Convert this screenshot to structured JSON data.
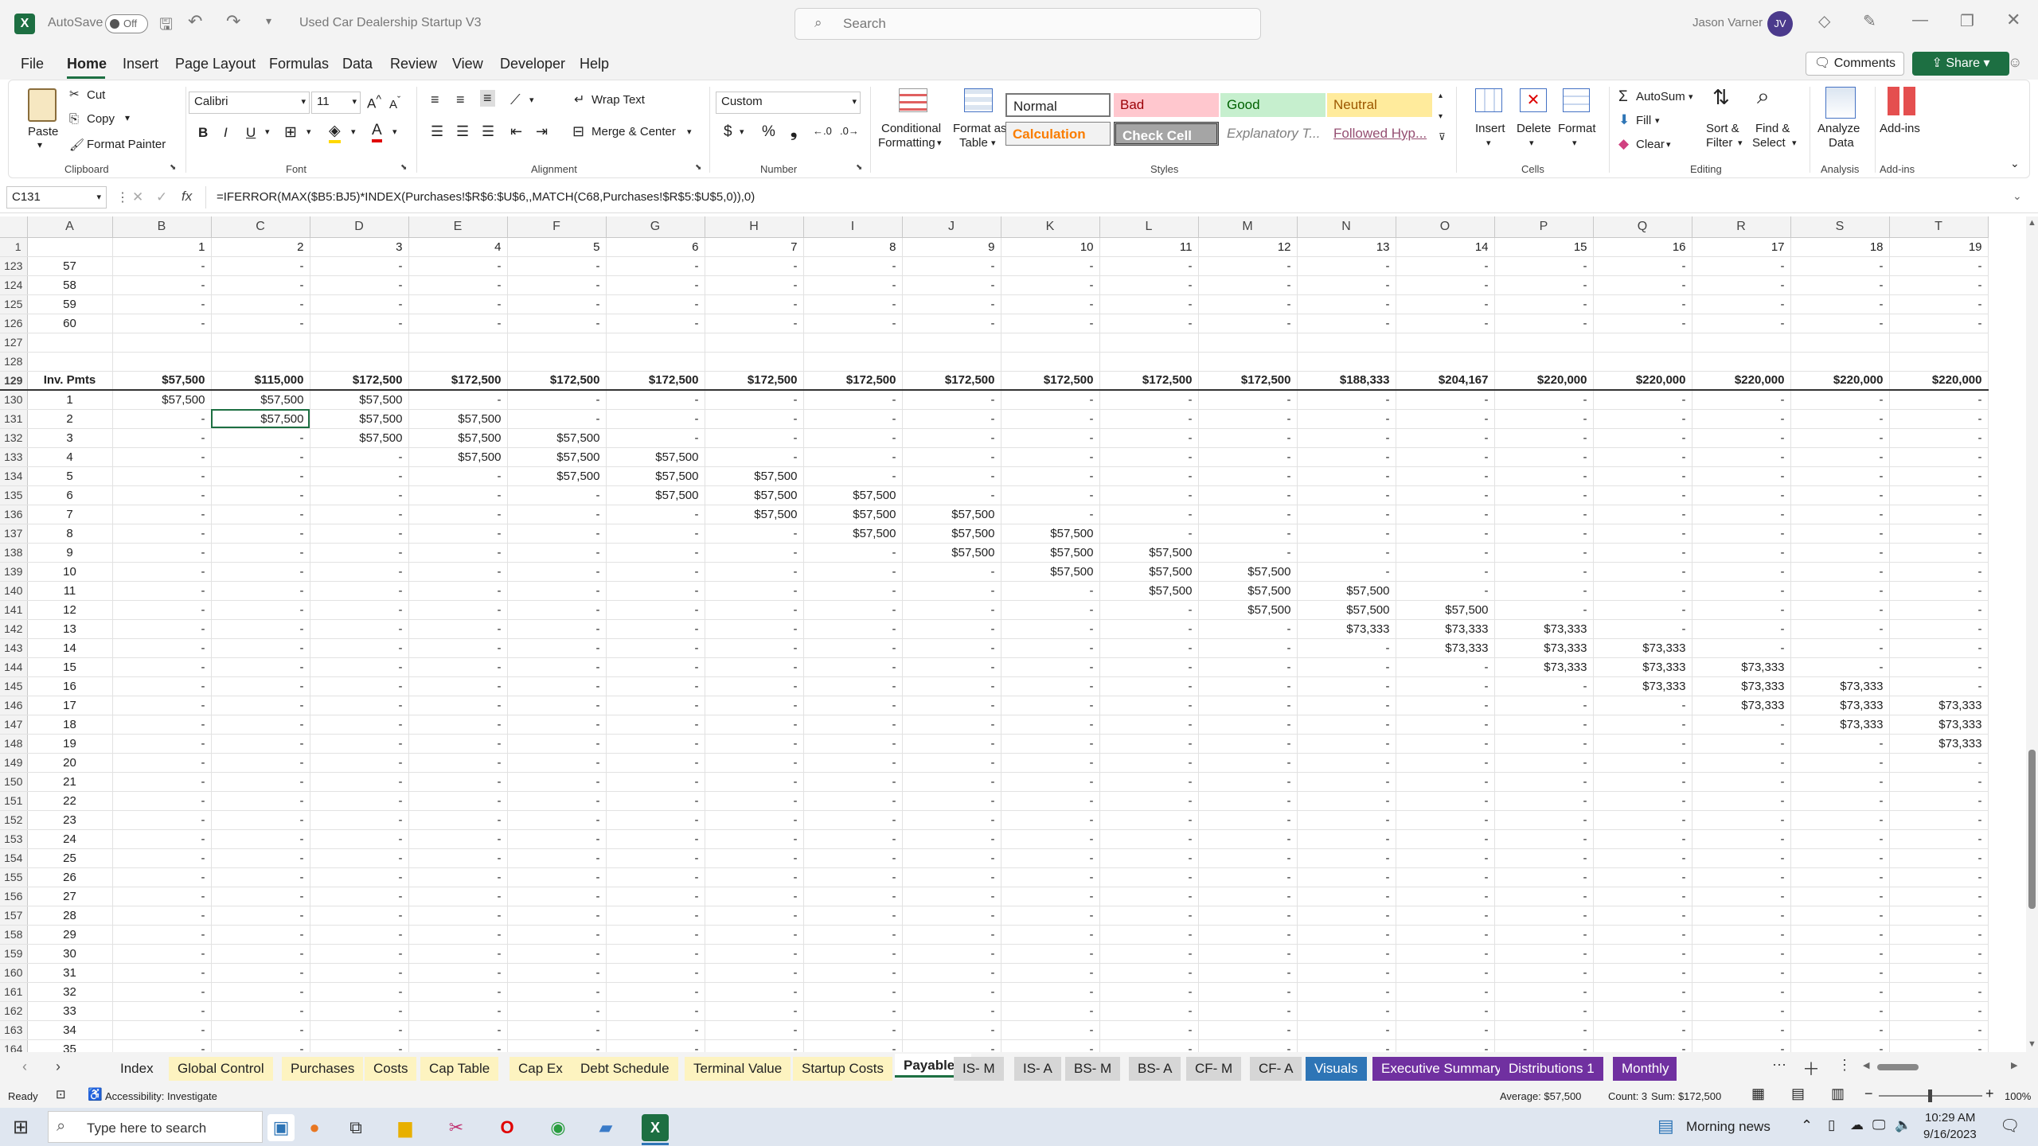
{
  "app": {
    "autosave_label": "AutoSave",
    "autosave_state": "Off",
    "doc_title": "Used Car Dealership Startup V3",
    "search_placeholder": "Search",
    "user_name": "Jason Varner",
    "user_initials": "JV"
  },
  "menu": [
    "File",
    "Home",
    "Insert",
    "Page Layout",
    "Formulas",
    "Data",
    "Review",
    "View",
    "Developer",
    "Help"
  ],
  "menu_active": "Home",
  "actions": {
    "comments": "Comments",
    "share": "Share"
  },
  "ribbon": {
    "clipboard": {
      "paste": "Paste",
      "cut": "Cut",
      "copy": "Copy",
      "format_painter": "Format Painter",
      "group": "Clipboard"
    },
    "font": {
      "name": "Calibri",
      "size": "11",
      "group": "Font"
    },
    "alignment": {
      "wrap": "Wrap Text",
      "merge": "Merge & Center",
      "group": "Alignment"
    },
    "number": {
      "format": "Custom",
      "group": "Number"
    },
    "styles": {
      "conditional": "Conditional",
      "formatting": "Formatting",
      "format_as": "Format as",
      "table": "Table",
      "normal": "Normal",
      "bad": "Bad",
      "good": "Good",
      "neutral": "Neutral",
      "calculation": "Calculation",
      "check_cell": "Check Cell",
      "explanatory": "Explanatory T...",
      "followed": "Followed Hyp...",
      "group": "Styles"
    },
    "cells": {
      "insert": "Insert",
      "delete": "Delete",
      "format": "Format",
      "group": "Cells"
    },
    "editing": {
      "autosum": "AutoSum",
      "fill": "Fill",
      "clear": "Clear",
      "sort1": "Sort &",
      "sort2": "Filter",
      "find1": "Find &",
      "find2": "Select",
      "group": "Editing"
    },
    "analysis": {
      "l1": "Analyze",
      "l2": "Data",
      "group": "Analysis"
    },
    "addins": {
      "label": "Add-ins",
      "group": "Add-ins"
    }
  },
  "formula_bar": {
    "name_box": "C131",
    "fx": "fx",
    "formula": "=IFERROR(MAX($B5:BJ5)*INDEX(Purchases!$R$6:$U$6,,MATCH(C68,Purchases!$R$5:$U$5,0)),0)"
  },
  "columns": [
    "A",
    "B",
    "C",
    "D",
    "E",
    "F",
    "G",
    "H",
    "I",
    "J",
    "K",
    "L",
    "M",
    "N",
    "O",
    "P",
    "Q",
    "R",
    "S",
    "T"
  ],
  "sheet": {
    "row1": [
      "1",
      "",
      "1",
      "2",
      "3",
      "4",
      "5",
      "6",
      "7",
      "8",
      "9",
      "10",
      "11",
      "12",
      "13",
      "14",
      "15",
      "16",
      "17",
      "18",
      "19"
    ],
    "rows": [
      [
        "123",
        "57",
        "-",
        "-",
        "-",
        "-",
        "-",
        "-",
        "-",
        "-",
        "-",
        "-",
        "-",
        "-",
        "-",
        "-",
        "-",
        "-",
        "-",
        "-",
        "-"
      ],
      [
        "124",
        "58",
        "-",
        "-",
        "-",
        "-",
        "-",
        "-",
        "-",
        "-",
        "-",
        "-",
        "-",
        "-",
        "-",
        "-",
        "-",
        "-",
        "-",
        "-",
        "-"
      ],
      [
        "125",
        "59",
        "-",
        "-",
        "-",
        "-",
        "-",
        "-",
        "-",
        "-",
        "-",
        "-",
        "-",
        "-",
        "-",
        "-",
        "-",
        "-",
        "-",
        "-",
        "-"
      ],
      [
        "126",
        "60",
        "-",
        "-",
        "-",
        "-",
        "-",
        "-",
        "-",
        "-",
        "-",
        "-",
        "-",
        "-",
        "-",
        "-",
        "-",
        "-",
        "-",
        "-",
        "-"
      ],
      [
        "127",
        "",
        "",
        "",
        "",
        "",
        "",
        "",
        "",
        "",
        "",
        "",
        "",
        "",
        "",
        "",
        "",
        "",
        "",
        "",
        ""
      ],
      [
        "128",
        "",
        "",
        "",
        "",
        "",
        "",
        "",
        "",
        "",
        "",
        "",
        "",
        "",
        "",
        "",
        "",
        "",
        "",
        "",
        ""
      ],
      [
        "129",
        "Inv. Pmts",
        "$57,500",
        "$115,000",
        "$172,500",
        "$172,500",
        "$172,500",
        "$172,500",
        "$172,500",
        "$172,500",
        "$172,500",
        "$172,500",
        "$172,500",
        "$172,500",
        "$188,333",
        "$204,167",
        "$220,000",
        "$220,000",
        "$220,000",
        "$220,000",
        "$220,000"
      ],
      [
        "130",
        "1",
        "$57,500",
        "$57,500",
        "$57,500",
        "-",
        "-",
        "-",
        "-",
        "-",
        "-",
        "-",
        "-",
        "-",
        "-",
        "-",
        "-",
        "-",
        "-",
        "-",
        "-"
      ],
      [
        "131",
        "2",
        "-",
        "$57,500",
        "$57,500",
        "$57,500",
        "-",
        "-",
        "-",
        "-",
        "-",
        "-",
        "-",
        "-",
        "-",
        "-",
        "-",
        "-",
        "-",
        "-",
        "-"
      ],
      [
        "132",
        "3",
        "-",
        "-",
        "$57,500",
        "$57,500",
        "$57,500",
        "-",
        "-",
        "-",
        "-",
        "-",
        "-",
        "-",
        "-",
        "-",
        "-",
        "-",
        "-",
        "-",
        "-"
      ],
      [
        "133",
        "4",
        "-",
        "-",
        "-",
        "$57,500",
        "$57,500",
        "$57,500",
        "-",
        "-",
        "-",
        "-",
        "-",
        "-",
        "-",
        "-",
        "-",
        "-",
        "-",
        "-",
        "-"
      ],
      [
        "134",
        "5",
        "-",
        "-",
        "-",
        "-",
        "$57,500",
        "$57,500",
        "$57,500",
        "-",
        "-",
        "-",
        "-",
        "-",
        "-",
        "-",
        "-",
        "-",
        "-",
        "-",
        "-"
      ],
      [
        "135",
        "6",
        "-",
        "-",
        "-",
        "-",
        "-",
        "$57,500",
        "$57,500",
        "$57,500",
        "-",
        "-",
        "-",
        "-",
        "-",
        "-",
        "-",
        "-",
        "-",
        "-",
        "-"
      ],
      [
        "136",
        "7",
        "-",
        "-",
        "-",
        "-",
        "-",
        "-",
        "$57,500",
        "$57,500",
        "$57,500",
        "-",
        "-",
        "-",
        "-",
        "-",
        "-",
        "-",
        "-",
        "-",
        "-"
      ],
      [
        "137",
        "8",
        "-",
        "-",
        "-",
        "-",
        "-",
        "-",
        "-",
        "$57,500",
        "$57,500",
        "$57,500",
        "-",
        "-",
        "-",
        "-",
        "-",
        "-",
        "-",
        "-",
        "-"
      ],
      [
        "138",
        "9",
        "-",
        "-",
        "-",
        "-",
        "-",
        "-",
        "-",
        "-",
        "$57,500",
        "$57,500",
        "$57,500",
        "-",
        "-",
        "-",
        "-",
        "-",
        "-",
        "-",
        "-"
      ],
      [
        "139",
        "10",
        "-",
        "-",
        "-",
        "-",
        "-",
        "-",
        "-",
        "-",
        "-",
        "$57,500",
        "$57,500",
        "$57,500",
        "-",
        "-",
        "-",
        "-",
        "-",
        "-",
        "-"
      ],
      [
        "140",
        "11",
        "-",
        "-",
        "-",
        "-",
        "-",
        "-",
        "-",
        "-",
        "-",
        "-",
        "$57,500",
        "$57,500",
        "$57,500",
        "-",
        "-",
        "-",
        "-",
        "-",
        "-"
      ],
      [
        "141",
        "12",
        "-",
        "-",
        "-",
        "-",
        "-",
        "-",
        "-",
        "-",
        "-",
        "-",
        "-",
        "$57,500",
        "$57,500",
        "$57,500",
        "-",
        "-",
        "-",
        "-",
        "-"
      ],
      [
        "142",
        "13",
        "-",
        "-",
        "-",
        "-",
        "-",
        "-",
        "-",
        "-",
        "-",
        "-",
        "-",
        "-",
        "$73,333",
        "$73,333",
        "$73,333",
        "-",
        "-",
        "-",
        "-"
      ],
      [
        "143",
        "14",
        "-",
        "-",
        "-",
        "-",
        "-",
        "-",
        "-",
        "-",
        "-",
        "-",
        "-",
        "-",
        "-",
        "$73,333",
        "$73,333",
        "$73,333",
        "-",
        "-",
        "-"
      ],
      [
        "144",
        "15",
        "-",
        "-",
        "-",
        "-",
        "-",
        "-",
        "-",
        "-",
        "-",
        "-",
        "-",
        "-",
        "-",
        "-",
        "$73,333",
        "$73,333",
        "$73,333",
        "-",
        "-"
      ],
      [
        "145",
        "16",
        "-",
        "-",
        "-",
        "-",
        "-",
        "-",
        "-",
        "-",
        "-",
        "-",
        "-",
        "-",
        "-",
        "-",
        "-",
        "$73,333",
        "$73,333",
        "$73,333",
        "-"
      ],
      [
        "146",
        "17",
        "-",
        "-",
        "-",
        "-",
        "-",
        "-",
        "-",
        "-",
        "-",
        "-",
        "-",
        "-",
        "-",
        "-",
        "-",
        "-",
        "$73,333",
        "$73,333",
        "$73,333"
      ],
      [
        "147",
        "18",
        "-",
        "-",
        "-",
        "-",
        "-",
        "-",
        "-",
        "-",
        "-",
        "-",
        "-",
        "-",
        "-",
        "-",
        "-",
        "-",
        "-",
        "$73,333",
        "$73,333"
      ],
      [
        "148",
        "19",
        "-",
        "-",
        "-",
        "-",
        "-",
        "-",
        "-",
        "-",
        "-",
        "-",
        "-",
        "-",
        "-",
        "-",
        "-",
        "-",
        "-",
        "-",
        "$73,333"
      ],
      [
        "149",
        "20",
        "-",
        "-",
        "-",
        "-",
        "-",
        "-",
        "-",
        "-",
        "-",
        "-",
        "-",
        "-",
        "-",
        "-",
        "-",
        "-",
        "-",
        "-",
        "-"
      ],
      [
        "150",
        "21",
        "-",
        "-",
        "-",
        "-",
        "-",
        "-",
        "-",
        "-",
        "-",
        "-",
        "-",
        "-",
        "-",
        "-",
        "-",
        "-",
        "-",
        "-",
        "-"
      ],
      [
        "151",
        "22",
        "-",
        "-",
        "-",
        "-",
        "-",
        "-",
        "-",
        "-",
        "-",
        "-",
        "-",
        "-",
        "-",
        "-",
        "-",
        "-",
        "-",
        "-",
        "-"
      ],
      [
        "152",
        "23",
        "-",
        "-",
        "-",
        "-",
        "-",
        "-",
        "-",
        "-",
        "-",
        "-",
        "-",
        "-",
        "-",
        "-",
        "-",
        "-",
        "-",
        "-",
        "-"
      ],
      [
        "153",
        "24",
        "-",
        "-",
        "-",
        "-",
        "-",
        "-",
        "-",
        "-",
        "-",
        "-",
        "-",
        "-",
        "-",
        "-",
        "-",
        "-",
        "-",
        "-",
        "-"
      ],
      [
        "154",
        "25",
        "-",
        "-",
        "-",
        "-",
        "-",
        "-",
        "-",
        "-",
        "-",
        "-",
        "-",
        "-",
        "-",
        "-",
        "-",
        "-",
        "-",
        "-",
        "-"
      ],
      [
        "155",
        "26",
        "-",
        "-",
        "-",
        "-",
        "-",
        "-",
        "-",
        "-",
        "-",
        "-",
        "-",
        "-",
        "-",
        "-",
        "-",
        "-",
        "-",
        "-",
        "-"
      ],
      [
        "156",
        "27",
        "-",
        "-",
        "-",
        "-",
        "-",
        "-",
        "-",
        "-",
        "-",
        "-",
        "-",
        "-",
        "-",
        "-",
        "-",
        "-",
        "-",
        "-",
        "-"
      ],
      [
        "157",
        "28",
        "-",
        "-",
        "-",
        "-",
        "-",
        "-",
        "-",
        "-",
        "-",
        "-",
        "-",
        "-",
        "-",
        "-",
        "-",
        "-",
        "-",
        "-",
        "-"
      ],
      [
        "158",
        "29",
        "-",
        "-",
        "-",
        "-",
        "-",
        "-",
        "-",
        "-",
        "-",
        "-",
        "-",
        "-",
        "-",
        "-",
        "-",
        "-",
        "-",
        "-",
        "-"
      ],
      [
        "159",
        "30",
        "-",
        "-",
        "-",
        "-",
        "-",
        "-",
        "-",
        "-",
        "-",
        "-",
        "-",
        "-",
        "-",
        "-",
        "-",
        "-",
        "-",
        "-",
        "-"
      ],
      [
        "160",
        "31",
        "-",
        "-",
        "-",
        "-",
        "-",
        "-",
        "-",
        "-",
        "-",
        "-",
        "-",
        "-",
        "-",
        "-",
        "-",
        "-",
        "-",
        "-",
        "-"
      ],
      [
        "161",
        "32",
        "-",
        "-",
        "-",
        "-",
        "-",
        "-",
        "-",
        "-",
        "-",
        "-",
        "-",
        "-",
        "-",
        "-",
        "-",
        "-",
        "-",
        "-",
        "-"
      ],
      [
        "162",
        "33",
        "-",
        "-",
        "-",
        "-",
        "-",
        "-",
        "-",
        "-",
        "-",
        "-",
        "-",
        "-",
        "-",
        "-",
        "-",
        "-",
        "-",
        "-",
        "-"
      ],
      [
        "163",
        "34",
        "-",
        "-",
        "-",
        "-",
        "-",
        "-",
        "-",
        "-",
        "-",
        "-",
        "-",
        "-",
        "-",
        "-",
        "-",
        "-",
        "-",
        "-",
        "-"
      ],
      [
        "164",
        "35",
        "-",
        "-",
        "-",
        "-",
        "-",
        "-",
        "-",
        "-",
        "-",
        "-",
        "-",
        "-",
        "-",
        "-",
        "-",
        "-",
        "-",
        "-",
        "-"
      ]
    ]
  },
  "tabs": [
    {
      "name": "Index",
      "color": "#f3f3f3"
    },
    {
      "name": "Global Control",
      "color": "#fdf3c0"
    },
    {
      "name": "Purchases",
      "color": "#fdf3c0"
    },
    {
      "name": "Costs",
      "color": "#fdf3c0"
    },
    {
      "name": "Cap Table",
      "color": "#fdf3c0"
    },
    {
      "name": "Cap Ex",
      "color": "#fdf3c0"
    },
    {
      "name": "Debt Schedule",
      "color": "#fdf3c0"
    },
    {
      "name": "Terminal Value",
      "color": "#fdf3c0"
    },
    {
      "name": "Startup Costs",
      "color": "#fdf3c0"
    },
    {
      "name": "Payables",
      "color": "#ffffff"
    },
    {
      "name": "IS- M",
      "color": "#d6d6d6"
    },
    {
      "name": "IS- A",
      "color": "#d6d6d6"
    },
    {
      "name": "BS- M",
      "color": "#d6d6d6"
    },
    {
      "name": "BS- A",
      "color": "#d6d6d6"
    },
    {
      "name": "CF- M",
      "color": "#d6d6d6"
    },
    {
      "name": "CF- A",
      "color": "#d6d6d6"
    },
    {
      "name": "Visuals",
      "color": "#2e75b6"
    },
    {
      "name": "Executive Summary",
      "color": "#7030a0"
    },
    {
      "name": "Distributions 1",
      "color": "#7030a0"
    },
    {
      "name": "Monthly",
      "color": "#7030a0"
    }
  ],
  "status": {
    "ready": "Ready",
    "accessibility": "Accessibility: Investigate",
    "average": "Average: $57,500",
    "count": "Count: 3",
    "sum": "Sum: $172,500",
    "zoom": "100%"
  },
  "taskbar": {
    "search_placeholder": "Type here to search",
    "news": "Morning news",
    "time": "10:29 AM",
    "date": "9/16/2023"
  }
}
